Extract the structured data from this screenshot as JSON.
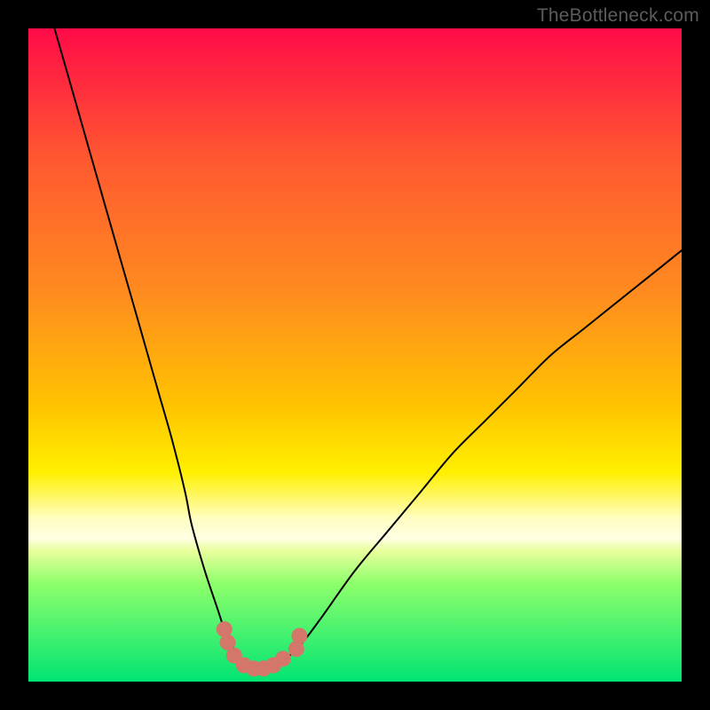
{
  "watermark": "TheBottleneck.com",
  "chart_data": {
    "type": "line",
    "title": "",
    "xlabel": "",
    "ylabel": "",
    "xlim": [
      0,
      100
    ],
    "ylim": [
      0,
      100
    ],
    "grid": false,
    "series": [
      {
        "name": "bottleneck-curve",
        "x": [
          4,
          6,
          8,
          10,
          12,
          14,
          16,
          18,
          20,
          22,
          24,
          25,
          27,
          29,
          30,
          31,
          32,
          33,
          34,
          35,
          36,
          37,
          38,
          39,
          40,
          42,
          45,
          50,
          55,
          60,
          65,
          70,
          75,
          80,
          85,
          90,
          95,
          100
        ],
        "y": [
          100,
          93,
          86,
          79,
          72,
          65,
          58,
          51,
          44,
          37,
          29,
          24,
          17,
          11,
          8,
          6,
          4,
          3,
          2,
          2,
          2,
          2,
          2,
          3,
          4,
          6,
          10,
          17,
          23,
          29,
          35,
          40,
          45,
          50,
          54,
          58,
          62,
          66
        ]
      }
    ],
    "markers": {
      "name": "link-markers",
      "color": "#d5766b",
      "points": [
        {
          "x": 30,
          "y": 8
        },
        {
          "x": 30.5,
          "y": 6
        },
        {
          "x": 31.5,
          "y": 4
        },
        {
          "x": 33,
          "y": 2.5
        },
        {
          "x": 34.5,
          "y": 2
        },
        {
          "x": 36,
          "y": 2
        },
        {
          "x": 37.5,
          "y": 2.5
        },
        {
          "x": 39,
          "y": 3.5
        },
        {
          "x": 41,
          "y": 5
        },
        {
          "x": 41.5,
          "y": 7
        }
      ]
    },
    "background_gradient": {
      "stops": [
        {
          "pos": 0.0,
          "color": "#ff0b48"
        },
        {
          "pos": 0.2,
          "color": "#ff5830"
        },
        {
          "pos": 0.4,
          "color": "#ff8a20"
        },
        {
          "pos": 0.58,
          "color": "#ffc400"
        },
        {
          "pos": 0.68,
          "color": "#fff000"
        },
        {
          "pos": 0.78,
          "color": "#ffffe4"
        },
        {
          "pos": 0.85,
          "color": "#8dff6c"
        },
        {
          "pos": 1.0,
          "color": "#00e472"
        }
      ]
    }
  }
}
